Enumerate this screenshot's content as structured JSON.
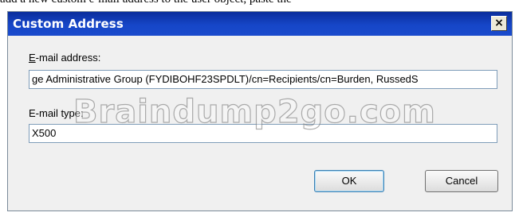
{
  "page": {
    "cropped_text": "add a new custom e-mail address to the user object, paste the"
  },
  "dialog": {
    "title": "Custom Address",
    "close_glyph": "×",
    "email_address": {
      "label_accel": "E",
      "label_rest": "-mail address:",
      "value": "ge Administrative Group (FYDIBOHF23SPDLT)/cn=Recipients/cn=Burden, RussedS"
    },
    "email_type": {
      "label": "E-mail type:",
      "value": "X500"
    },
    "ok_label": "OK",
    "cancel_label": "Cancel"
  },
  "watermark": "Braindump2go.com",
  "colors": {
    "titlebar": "#1646c8",
    "dialog_bg": "#f0f0f0",
    "field_border": "#7f9db9"
  },
  "icons": {
    "close": "close-icon"
  }
}
